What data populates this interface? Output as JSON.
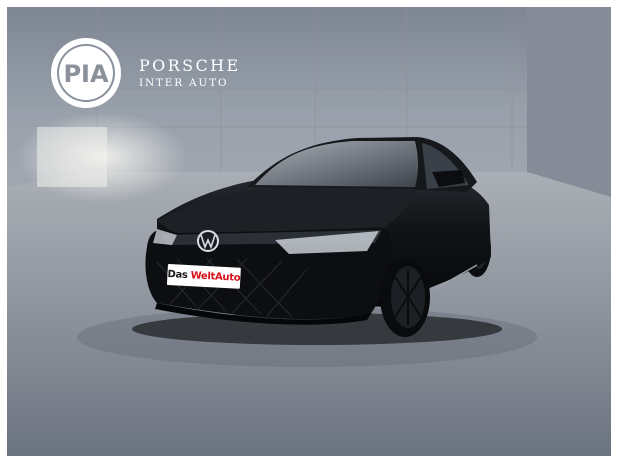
{
  "dealer": {
    "logo_letters": "PIA",
    "name": "PORSCHE",
    "subtitle": "INTER AUTO"
  },
  "vehicle": {
    "plate_part1": "Das",
    "plate_part2": "WeltAuto"
  },
  "colors": {
    "logo_fill": "#ffffff",
    "plate_accent": "#d8101b",
    "body_paint": "#121418",
    "sky_wall": "#8f96a1"
  }
}
